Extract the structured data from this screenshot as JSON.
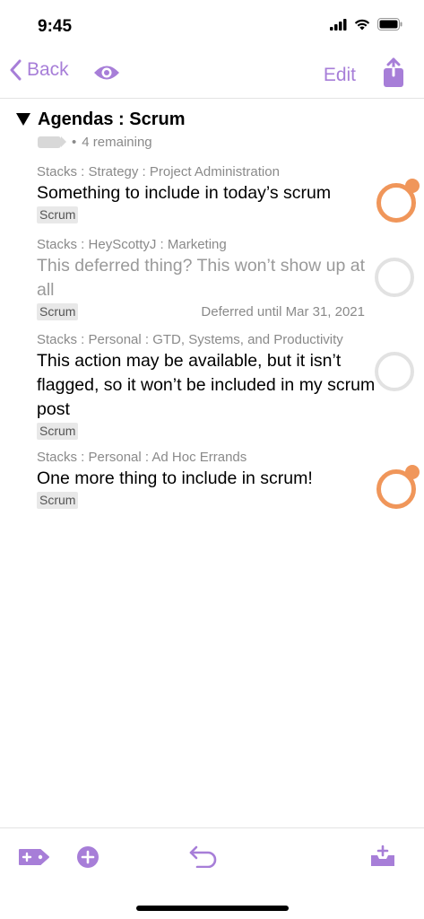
{
  "status_bar": {
    "time": "9:45"
  },
  "nav": {
    "back_label": "Back",
    "edit_label": "Edit",
    "accent_color": "#a77ed8"
  },
  "section": {
    "title": "Agendas : Scrum",
    "remaining": "4 remaining",
    "separator": "•"
  },
  "tasks": [
    {
      "path": "Stacks : Strategy : Project Administration",
      "title": "Something to include in today’s scrum",
      "tag": "Scrum",
      "flagged": true,
      "deferred": false,
      "note": ""
    },
    {
      "path": "Stacks : HeyScottyJ : Marketing",
      "title": "This deferred thing? This won’t show up at all",
      "tag": "Scrum",
      "flagged": false,
      "deferred": true,
      "note": "Deferred until Mar 31, 2021"
    },
    {
      "path": "Stacks : Personal : GTD, Systems, and Productivity",
      "title": "This action may be available, but it isn’t flagged, so it won’t be included in my scrum post",
      "tag": "Scrum",
      "flagged": false,
      "deferred": false,
      "note": ""
    },
    {
      "path": "Stacks : Personal : Ad Hoc Errands",
      "title": "One more thing to include in scrum!",
      "tag": "Scrum",
      "flagged": true,
      "deferred": false,
      "note": ""
    }
  ],
  "colors": {
    "accent": "#a77ed8",
    "flag": "#f0965a",
    "secondary_text": "#8a8a8a",
    "tag_bg": "#e8e8e8"
  },
  "toolbar": {
    "icons": [
      "add-tag-icon",
      "add-item-icon",
      "undo-icon",
      "inbox-add-icon"
    ]
  }
}
